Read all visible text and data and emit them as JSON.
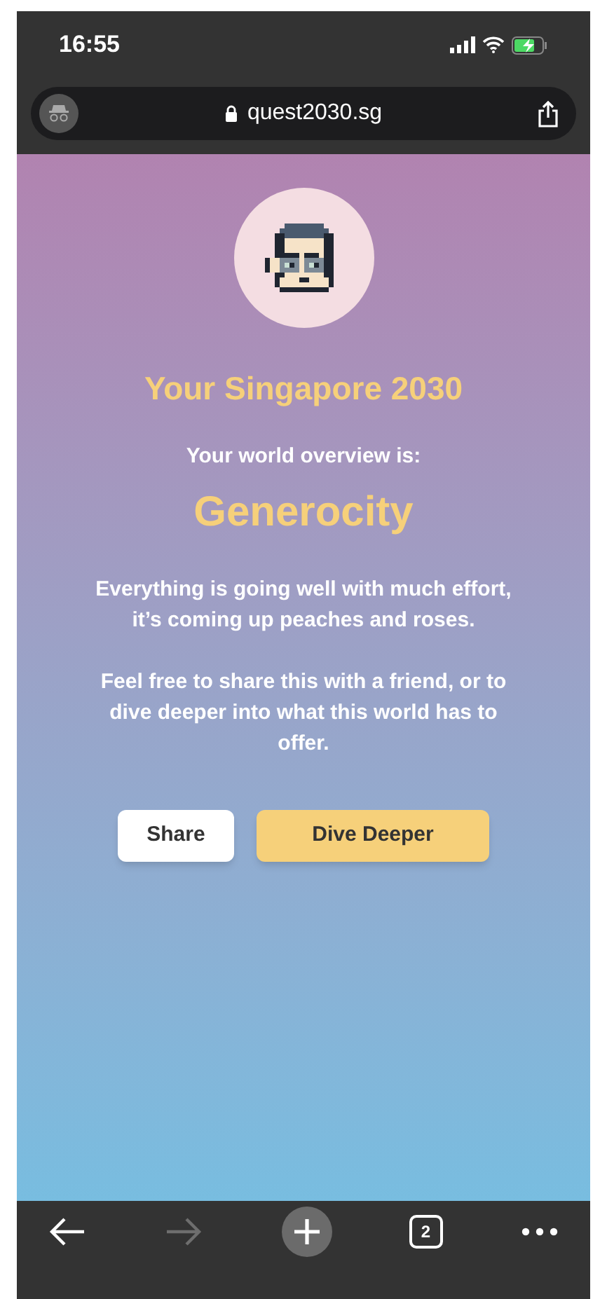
{
  "status_bar": {
    "time": "16:55"
  },
  "address_bar": {
    "url": "quest2030.sg"
  },
  "page": {
    "title": "Your Singapore 2030",
    "overview_label": "Your world overview is:",
    "overview": "Generocity",
    "paragraphs": [
      "Everything is going well with much effort, it’s coming up peaches and roses.",
      "Feel free to share this with a friend, or to dive deeper into what this world has to offer."
    ],
    "buttons": [
      {
        "label": "Share",
        "kind": "secondary"
      },
      {
        "label": "Dive Deeper",
        "kind": "primary"
      }
    ]
  },
  "toolbar": {
    "back": {
      "disabled": false
    },
    "forward": {
      "disabled": true
    },
    "tab_count": "2"
  }
}
